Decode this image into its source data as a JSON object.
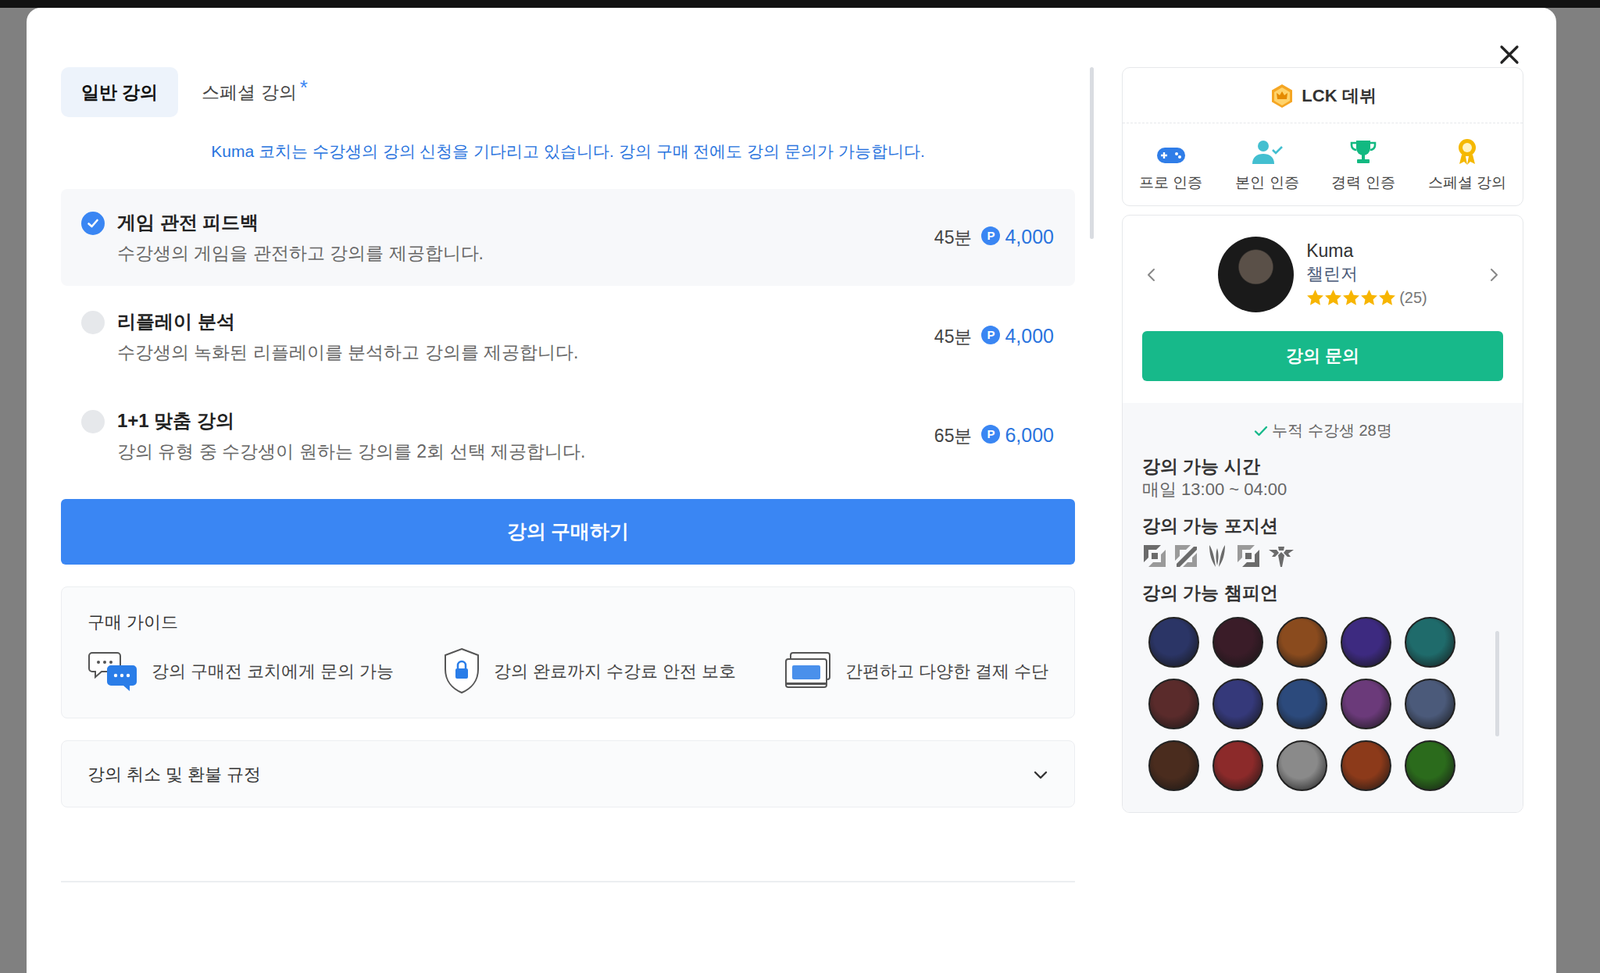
{
  "tabs": [
    {
      "label": "일반 강의",
      "selected": true
    },
    {
      "label": "스페셜 강의",
      "selected": false,
      "badge": "*"
    }
  ],
  "notice": "Kuma 코치는 수강생의 강의 신청을 기다리고 있습니다. 강의 구매 전에도 강의 문의가 가능합니다.",
  "currency": "P",
  "lessons": [
    {
      "title": "게임 관전 피드백",
      "desc": "수강생의 게임을 관전하고 강의를 제공합니다.",
      "duration": "45분",
      "price": "4,000",
      "selected": true
    },
    {
      "title": "리플레이 분석",
      "desc": "수강생의 녹화된 리플레이를 분석하고 강의를 제공합니다.",
      "duration": "45분",
      "price": "4,000",
      "selected": false
    },
    {
      "title": "1+1 맞춤 강의",
      "desc": "강의 유형 중 수강생이 원하는 강의를 2회 선택 제공합니다.",
      "duration": "65분",
      "price": "6,000",
      "selected": false
    }
  ],
  "buy_button": "강의 구매하기",
  "guide": {
    "title": "구매 가이드",
    "items": [
      "강의 구매전 코치에게 문의 가능",
      "강의 완료까지 수강료 안전 보호",
      "간편하고 다양한 결제 수단"
    ]
  },
  "refund": {
    "title": "강의 취소 및 환불 규정",
    "expanded": false
  },
  "badge_card": {
    "title": "LCK 데뷔",
    "certs": [
      "프로 인증",
      "본인 인증",
      "경력 인증",
      "스페셜 강의"
    ]
  },
  "coach": {
    "name": "Kuma",
    "tier": "챌린저",
    "stars": 5,
    "reviews": "(25)"
  },
  "inquiry_button": "강의 문의",
  "students": "누적 수강생 28명",
  "hours": {
    "label": "강의 가능 시간",
    "value": "매일 13:00 ~ 04:00"
  },
  "positions": {
    "label": "강의 가능 포지션"
  },
  "champions": {
    "label": "강의 가능 챔피언",
    "items": [
      {
        "color": "#2b3566"
      },
      {
        "color": "#3a1c28"
      },
      {
        "color": "#8a4b1e"
      },
      {
        "color": "#3d2a80"
      },
      {
        "color": "#1f6b6b"
      },
      {
        "color": "#5a2b2b"
      },
      {
        "color": "#35397a"
      },
      {
        "color": "#2c4a7c"
      },
      {
        "color": "#6b3a7a"
      },
      {
        "color": "#4b5a7a"
      },
      {
        "color": "#4a2c1e"
      },
      {
        "color": "#8c2a2a"
      },
      {
        "color": "#8a8a8a"
      },
      {
        "color": "#8c3a1a"
      },
      {
        "color": "#2b6b1c"
      }
    ]
  }
}
